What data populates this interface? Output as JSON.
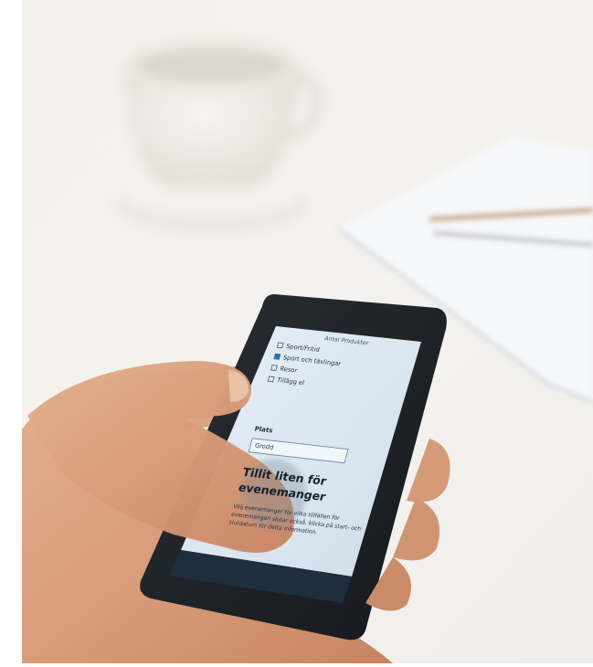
{
  "screen": {
    "title": "Antal Produkter",
    "options": [
      {
        "label": "Sport/Fritid",
        "checked": false
      },
      {
        "label": "Sport och tävlingar",
        "checked": true
      },
      {
        "label": "Resor",
        "checked": false
      },
      {
        "label": "Tillägg el",
        "checked": false
      }
    ],
    "platform_label": "Plats",
    "platform_value": "Grodd",
    "heading": "Tillit liten för evenemanger",
    "body": "Välj evenemanger för vilka tillfällen för evenemangen slutar också, klicka på start- och slutdatum för detta information."
  },
  "colors": {
    "screen_bg": "#dfeaf4",
    "accent": "#2c6fb3",
    "phone_body": "#1b1f24"
  }
}
